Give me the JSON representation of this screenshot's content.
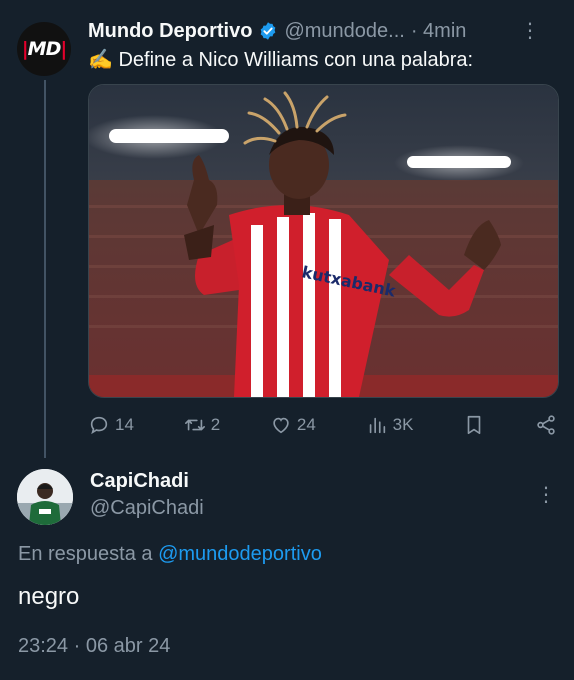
{
  "tweet": {
    "author_name": "Mundo Deportivo",
    "author_handle": "@mundode...",
    "time_ago": "· 4min",
    "text": "✍️ Define a Nico Williams con una palabra:",
    "avatar_logo": "MD",
    "verified_color": "#1d9bf0",
    "actions": {
      "replies": "14",
      "reposts": "2",
      "likes": "24",
      "views": "3K"
    },
    "icons": [
      "reply-icon",
      "repost-icon",
      "like-icon",
      "views-icon",
      "bookmark-icon",
      "share-icon",
      "more-icon"
    ]
  },
  "reply": {
    "author_name": "CapiChadi",
    "author_handle": "@CapiChadi",
    "replying_to_label": "En respuesta a",
    "replying_to_mention": "@mundodeportivo",
    "text": "negro",
    "timestamp": "23:24 · 06 abr 24"
  },
  "colors": {
    "background": "#15202b",
    "text_primary": "#f7f9f9",
    "text_secondary": "#8b98a5",
    "accent": "#1d9bf0"
  }
}
